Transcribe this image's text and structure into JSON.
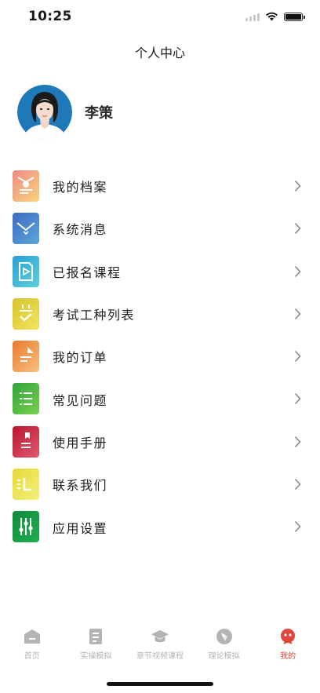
{
  "status_bar": {
    "time": "10:25"
  },
  "header": {
    "title": "个人中心"
  },
  "profile": {
    "name": "李策"
  },
  "menu": {
    "items": [
      {
        "label": "我的档案",
        "icon": "profile-card-icon"
      },
      {
        "label": "系统消息",
        "icon": "envelope-icon"
      },
      {
        "label": "已报名课程",
        "icon": "video-doc-icon"
      },
      {
        "label": "考试工种列表",
        "icon": "checklist-notepad-icon"
      },
      {
        "label": "我的订单",
        "icon": "document-icon"
      },
      {
        "label": "常见问题",
        "icon": "list-icon"
      },
      {
        "label": "使用手册",
        "icon": "manual-book-icon"
      },
      {
        "label": "联系我们",
        "icon": "contact-icon"
      },
      {
        "label": "应用设置",
        "icon": "sliders-icon"
      }
    ]
  },
  "tabbar": {
    "tabs": [
      {
        "label": "首页",
        "icon": "home-icon"
      },
      {
        "label": "实操模拟",
        "icon": "clipboard-icon"
      },
      {
        "label": "章节视频课程",
        "icon": "graduation-cap-icon"
      },
      {
        "label": "理论模拟",
        "icon": "compass-icon"
      },
      {
        "label": "我的",
        "icon": "user-face-icon",
        "active": true
      }
    ]
  },
  "colors": {
    "accent": "#e0463e",
    "inactive": "#b4b4b4"
  }
}
